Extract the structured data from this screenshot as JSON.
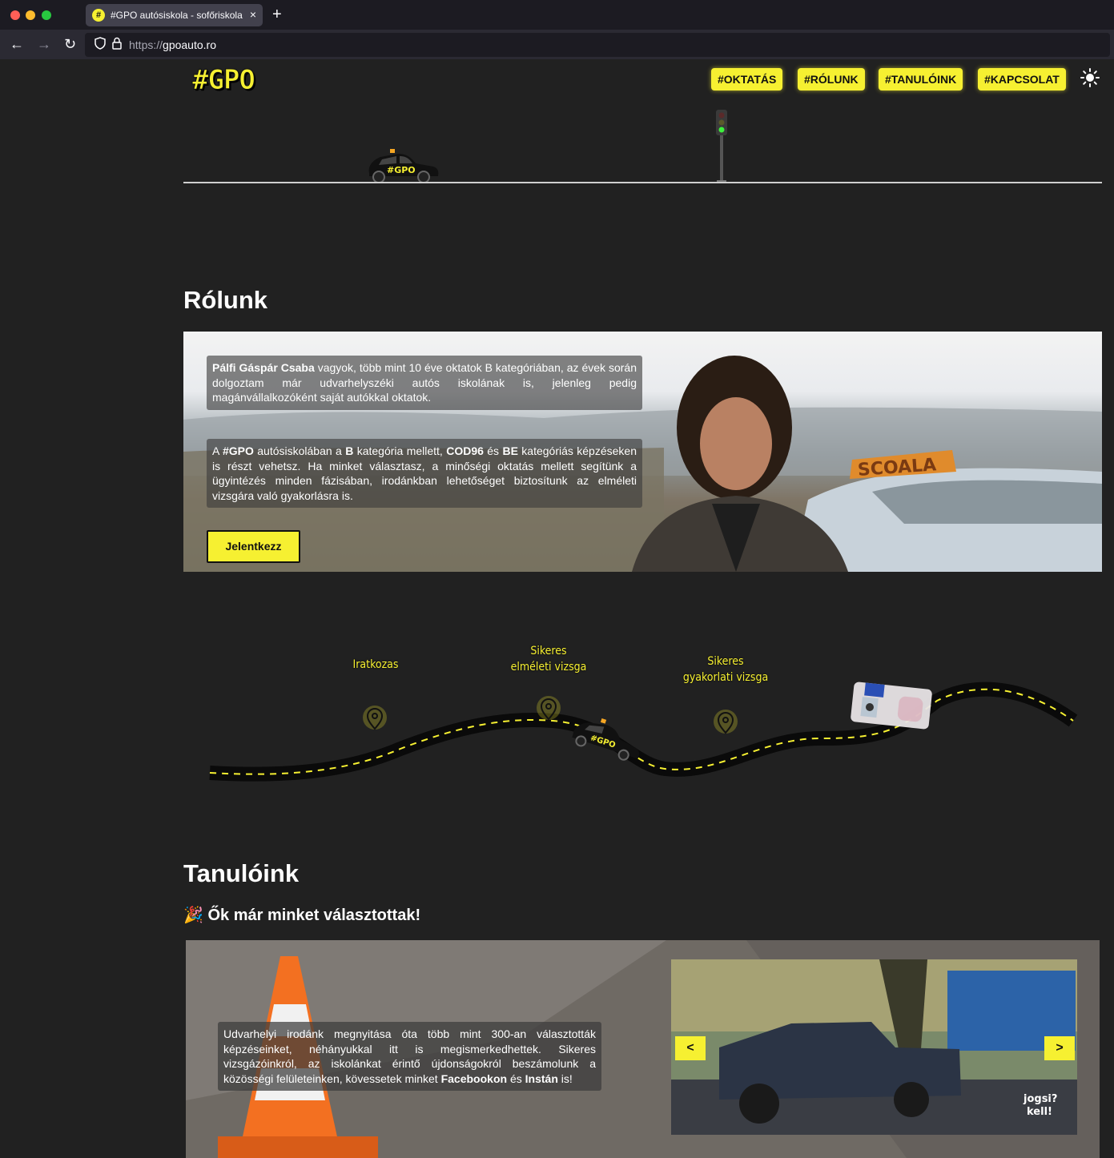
{
  "browser": {
    "tab_title": "#GPO autósiskola - sofőriskola",
    "tab_close": "×",
    "new_tab": "+",
    "url_protocol": "https://",
    "url_domain": "gpoauto.ro",
    "back": "←",
    "forward": "→",
    "reload": "↻"
  },
  "header": {
    "logo": "#GPO",
    "nav": [
      "#OKTATÁS",
      "#RÓLUNK",
      "#TANULÓINK",
      "#KAPCSOLAT"
    ],
    "car_label": "#GPO"
  },
  "about": {
    "title": "Rólunk",
    "p1_name": "Pálfi Gáspár Csaba",
    "p1_rest": " vagyok, több mint 10 éve oktatok B kategóriában, az évek során dolgoztam már udvarhelyszéki autós iskolának is, jelenleg pedig magánvállalkozóként saját autókkal oktatok.",
    "p2_a": "A ",
    "p2_brand": "#GPO",
    "p2_b": " autósiskolában a ",
    "p2_cat_b": "B",
    "p2_c": " kategória mellett, ",
    "p2_cod": "COD96",
    "p2_d": " és ",
    "p2_be": "BE",
    "p2_e": " kategóriás képzéseken is részt vehetsz. Ha minket választasz, a minőségi oktatás mellett segítünk a ügyintézés minden fázisában, irodánkban lehetőséget biztosítunk az elméleti vizsgára való gyakorlásra is.",
    "button": "Jelentkezz",
    "sign_text": "SCOALA"
  },
  "timeline": {
    "step1": "Iratkozas",
    "step2_l1": "Sikeres",
    "step2_l2": "elméleti vizsga",
    "step3_l1": "Sikeres",
    "step3_l2": "gyakorlati vizsga",
    "car_label": "#GPO"
  },
  "students": {
    "title": "Tanulóink",
    "subtitle_emoji": "🎉",
    "subtitle": "Ők már minket választottak!",
    "text_a": "Udvarhelyi irodánk megnyitása óta több mint 300-an választották képzéseinket, néhányukkal itt is megismerkedhettek. Sikeres vizsgázóinkról, az iskolánkat érintő újdonságokról beszámolunk a közösségi felületeinken, kövessetek minket ",
    "text_fb": "Facebookon",
    "text_and": " és ",
    "text_insta": "Instán",
    "text_end": " is!",
    "prev": "<",
    "next": ">",
    "watermark_l1": "jogsi?",
    "watermark_l2": "kell!"
  },
  "colors": {
    "accent": "#f6f031",
    "background": "#212121"
  }
}
